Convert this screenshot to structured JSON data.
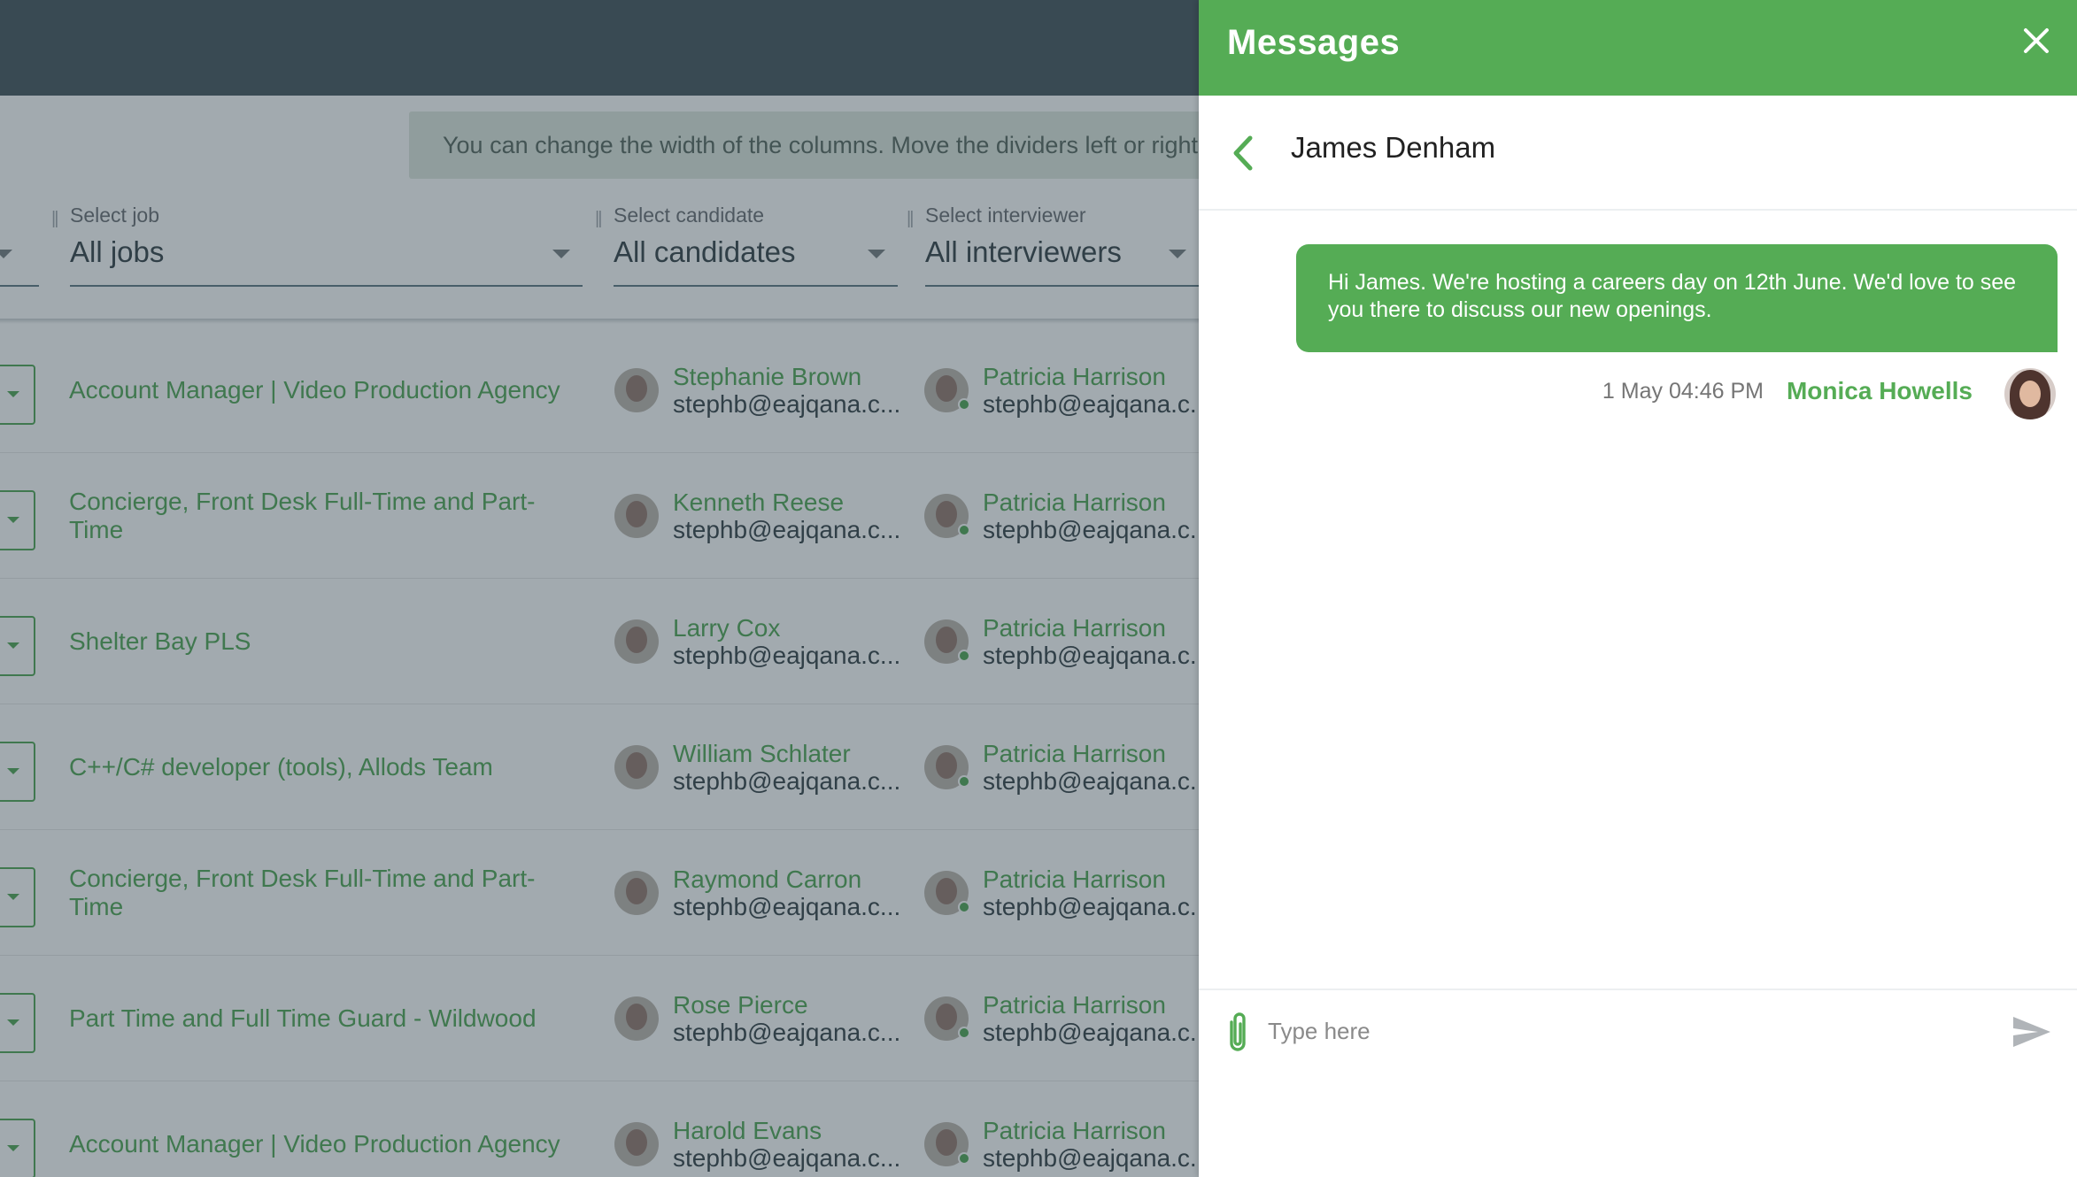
{
  "background_app": {
    "hint": "You can change the width of the columns. Move the dividers left or right",
    "filters": [
      {
        "label": "Select job",
        "value": "All jobs"
      },
      {
        "label": "Select candidate",
        "value": "All candidates"
      },
      {
        "label": "Select interviewer",
        "value": "All interviewers"
      }
    ],
    "rows": [
      {
        "job": "Account Manager | Video Production Agency",
        "candidate": "Stephanie Brown",
        "candidate_email": "stephb@eajqana.c...",
        "interviewer": "Patricia Harrison",
        "interviewer_email": "stephb@eajqana.c..."
      },
      {
        "job": "Concierge, Front Desk Full-Time and Part-Time",
        "candidate": "Kenneth Reese",
        "candidate_email": "stephb@eajqana.c...",
        "interviewer": "Patricia Harrison",
        "interviewer_email": "stephb@eajqana.c..."
      },
      {
        "job": "Shelter Bay PLS",
        "candidate": "Larry Cox",
        "candidate_email": "stephb@eajqana.c...",
        "interviewer": "Patricia Harrison",
        "interviewer_email": "stephb@eajqana.c..."
      },
      {
        "job": "C++/C# developer (tools), Allods Team",
        "candidate": "William Schlater",
        "candidate_email": "stephb@eajqana.c...",
        "interviewer": "Patricia Harrison",
        "interviewer_email": "stephb@eajqana.c..."
      },
      {
        "job": "Concierge, Front Desk Full-Time and Part-Time",
        "candidate": "Raymond Carron",
        "candidate_email": "stephb@eajqana.c...",
        "interviewer": "Patricia Harrison",
        "interviewer_email": "stephb@eajqana.c..."
      },
      {
        "job": "Part Time and Full Time Guard - Wildwood",
        "candidate": "Rose Pierce",
        "candidate_email": "stephb@eajqana.c...",
        "interviewer": "Patricia Harrison",
        "interviewer_email": "stephb@eajqana.c..."
      },
      {
        "job": "Account Manager | Video Production Agency",
        "candidate": "Harold Evans",
        "candidate_email": "stephb@eajqana.c...",
        "interviewer": "Patricia Harrison",
        "interviewer_email": "stephb@eajqana.c..."
      }
    ]
  },
  "messages_panel": {
    "title": "Messages",
    "contact_name": "James Denham",
    "messages": [
      {
        "text": "Hi James. We're hosting a careers day on 12th June. We'd love to see you there to discuss our new openings.",
        "time": "1 May 04:46 PM",
        "author": "Monica Howells"
      }
    ],
    "composer": {
      "placeholder": "Type here",
      "value": ""
    }
  },
  "icons": {
    "close": "close-icon",
    "back": "chevron-left-icon",
    "attach": "paperclip-icon",
    "send": "send-icon",
    "dropdown": "caret-down-icon"
  },
  "colors": {
    "accent_green": "#55ac55",
    "link_green": "#43a047",
    "topbar": "#37474f"
  }
}
